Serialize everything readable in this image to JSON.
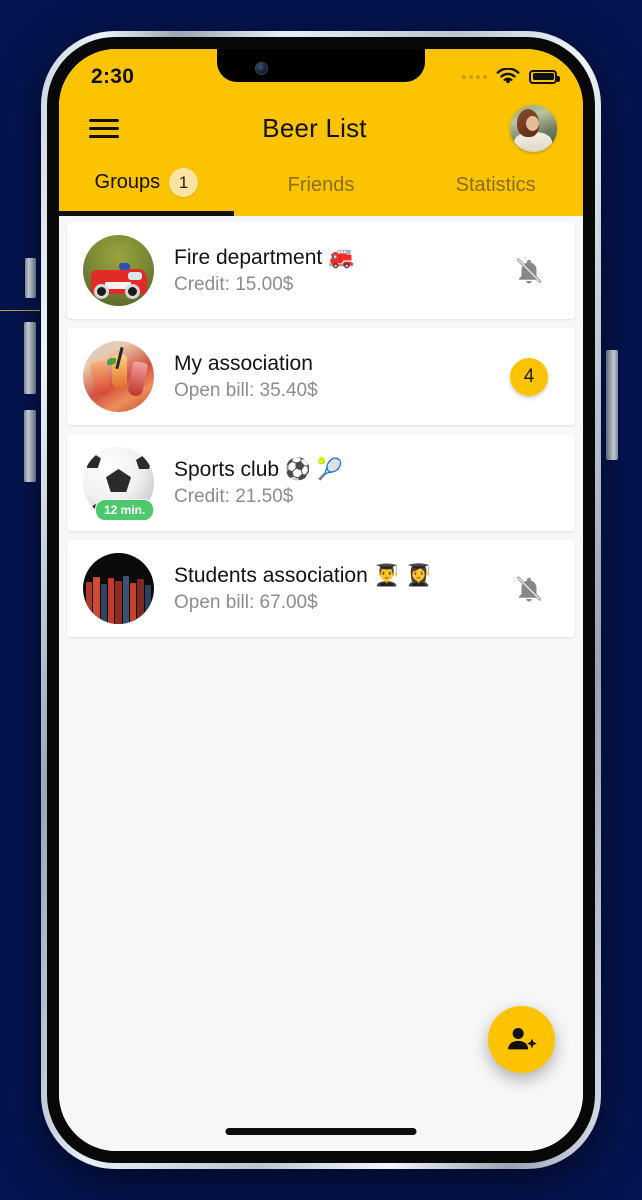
{
  "status_bar": {
    "time": "2:30",
    "signal_icon": "signal-dots-icon",
    "wifi_icon": "wifi-icon",
    "battery_icon": "battery-full-icon"
  },
  "app_bar": {
    "menu_icon": "hamburger-menu-icon",
    "title": "Beer List",
    "profile_avatar": "user-avatar"
  },
  "tabs": [
    {
      "label": "Groups",
      "badge": "1",
      "active": true
    },
    {
      "label": "Friends",
      "badge": "",
      "active": false
    },
    {
      "label": "Statistics",
      "badge": "",
      "active": false
    }
  ],
  "groups": [
    {
      "name": "Fire department 🚒",
      "detail": "Credit: 15.00$",
      "avatar": "fire-truck-avatar",
      "trailing_type": "bell-off-icon",
      "trailing_value": "",
      "time_badge": ""
    },
    {
      "name": "My association",
      "detail": "Open bill: 35.40$",
      "avatar": "drinks-cheers-avatar",
      "trailing_type": "count-badge",
      "trailing_value": "4",
      "time_badge": ""
    },
    {
      "name": "Sports club ⚽ 🎾",
      "detail": "Credit: 21.50$",
      "avatar": "soccer-ball-avatar",
      "trailing_type": "none",
      "trailing_value": "",
      "time_badge": "12 min."
    },
    {
      "name": "Students association 👨‍🎓 👩‍🎓",
      "detail": "Open bill: 67.00$",
      "avatar": "books-avatar",
      "trailing_type": "bell-off-icon",
      "trailing_value": "",
      "time_badge": ""
    }
  ],
  "fab": {
    "icon": "person-add-icon"
  },
  "colors": {
    "brand_yellow": "#FCC400",
    "tab_badge": "#FBE4A2",
    "time_badge_green": "#4CC96A",
    "page_background": "#041450",
    "content_background": "#F7F7F7"
  }
}
